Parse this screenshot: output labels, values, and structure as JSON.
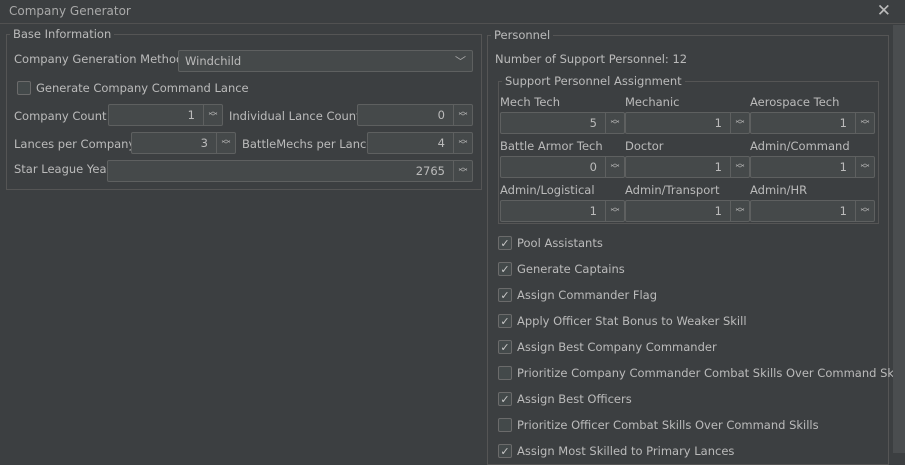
{
  "window": {
    "title": "Company Generator",
    "close_icon": "close-icon"
  },
  "base": {
    "legend": "Base Information",
    "method_label": "Company Generation Method",
    "method_value": "Windchild",
    "command_lance_label": "Generate Company Command Lance",
    "command_lance_checked": false,
    "company_count_label": "Company Count",
    "company_count": "1",
    "individual_lance_label": "Individual Lance Count",
    "individual_lance": "0",
    "lances_label": "Lances per Company",
    "lances": "3",
    "mechs_label": "BattleMechs per Lance",
    "mechs": "4",
    "sl_year_label": "Star League Year",
    "sl_year": "2765"
  },
  "personnel": {
    "legend": "Personnel",
    "support_count": "Number of Support Personnel: 12",
    "assignment_legend": "Support Personnel Assignment",
    "roles": [
      {
        "label": "Mech Tech",
        "value": "5"
      },
      {
        "label": "Mechanic",
        "value": "1"
      },
      {
        "label": "Aerospace Tech",
        "value": "1"
      },
      {
        "label": "Battle Armor Tech",
        "value": "0"
      },
      {
        "label": "Doctor",
        "value": "1"
      },
      {
        "label": "Admin/Command",
        "value": "1"
      },
      {
        "label": "Admin/Logistical",
        "value": "1"
      },
      {
        "label": "Admin/Transport",
        "value": "1"
      },
      {
        "label": "Admin/HR",
        "value": "1"
      }
    ],
    "options": [
      {
        "label": "Pool Assistants",
        "checked": true
      },
      {
        "label": "Generate Captains",
        "checked": true
      },
      {
        "label": "Assign Commander Flag",
        "checked": true
      },
      {
        "label": "Apply Officer Stat Bonus to Weaker Skill",
        "checked": true
      },
      {
        "label": "Assign Best Company Commander",
        "checked": true
      },
      {
        "label": "Prioritize Company Commander Combat Skills Over Command Skills",
        "checked": false
      },
      {
        "label": "Assign Best Officers",
        "checked": true
      },
      {
        "label": "Prioritize Officer Combat Skills Over Command Skills",
        "checked": false
      },
      {
        "label": "Assign Most Skilled to Primary Lances",
        "checked": true
      }
    ]
  }
}
